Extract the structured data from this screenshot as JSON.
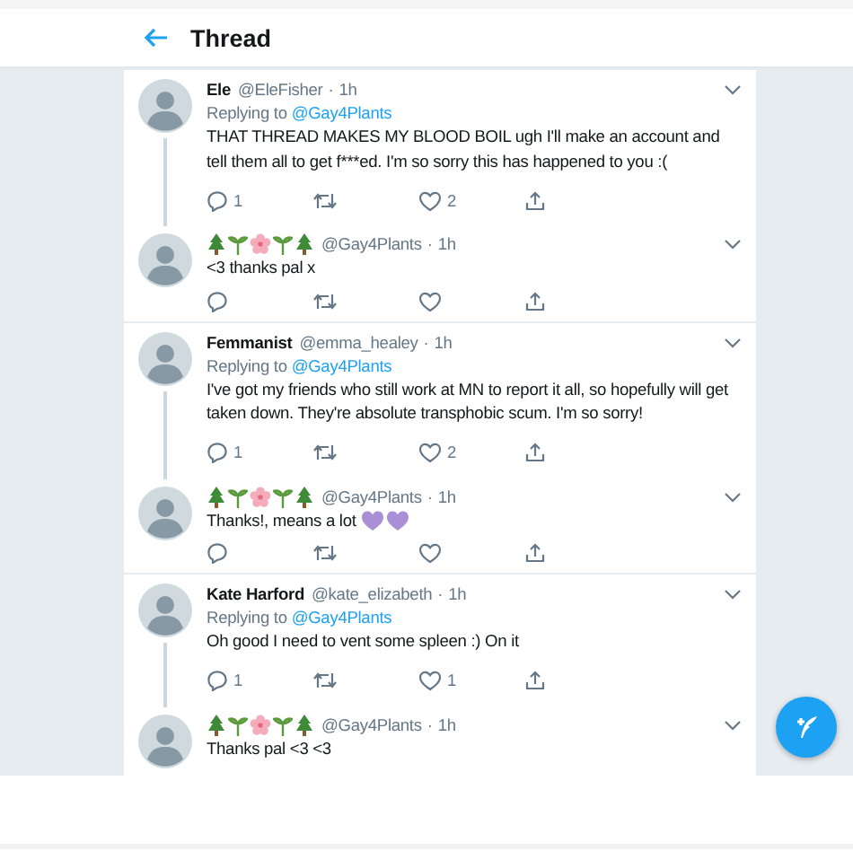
{
  "header": {
    "title": "Thread"
  },
  "tweets": [
    {
      "kind": "parent",
      "name": "Ele",
      "handle": "@EleFisher",
      "separator": "·",
      "time": "1h",
      "replying_label": "Replying to",
      "replying_to": "@Gay4Plants",
      "text": "THAT THREAD MAKES MY BLOOD BOIL ugh I'll make an account and tell them all to get f***ed. I'm so sorry this has happened to you :(",
      "replies": "1",
      "likes": "2"
    },
    {
      "kind": "reply",
      "name_icons": [
        {
          "kind": "tree"
        },
        {
          "kind": "sprout"
        },
        {
          "kind": "flower"
        },
        {
          "kind": "sprout"
        },
        {
          "kind": "tree"
        }
      ],
      "handle": "@Gay4Plants",
      "separator": "·",
      "time": "1h",
      "text": "<3 thanks pal x",
      "actions": true
    },
    {
      "kind": "parent",
      "name": "Femmanist",
      "handle": "@emma_healey",
      "separator": "·",
      "time": "1h",
      "replying_label": "Replying to",
      "replying_to": "@Gay4Plants",
      "text": "I've got my friends who still work at MN to report it all, so hopefully will get taken down. They're absolute transphobic scum. I'm so sorry!",
      "replies": "1",
      "likes": "2"
    },
    {
      "kind": "reply",
      "name_icons": [
        {
          "kind": "tree"
        },
        {
          "kind": "sprout"
        },
        {
          "kind": "flower"
        },
        {
          "kind": "sprout"
        },
        {
          "kind": "tree"
        }
      ],
      "handle": "@Gay4Plants",
      "separator": "·",
      "time": "1h",
      "text": "Thanks!, means a lot",
      "text_icons": [
        {
          "kind": "heart"
        },
        {
          "kind": "heart"
        }
      ],
      "actions": true
    },
    {
      "kind": "parent",
      "name": "Kate Harford",
      "handle": "@kate_elizabeth",
      "separator": "·",
      "time": "1h",
      "replying_label": "Replying to",
      "replying_to": "@Gay4Plants",
      "text": "Oh good I need to vent some spleen :) On it",
      "replies": "1",
      "likes": "1"
    },
    {
      "kind": "reply",
      "name_icons": [
        {
          "kind": "tree"
        },
        {
          "kind": "sprout"
        },
        {
          "kind": "flower"
        },
        {
          "kind": "sprout"
        },
        {
          "kind": "tree"
        }
      ],
      "handle": "@Gay4Plants",
      "separator": "·",
      "time": "1h",
      "text": "Thanks pal <3 <3",
      "actions": false
    }
  ]
}
